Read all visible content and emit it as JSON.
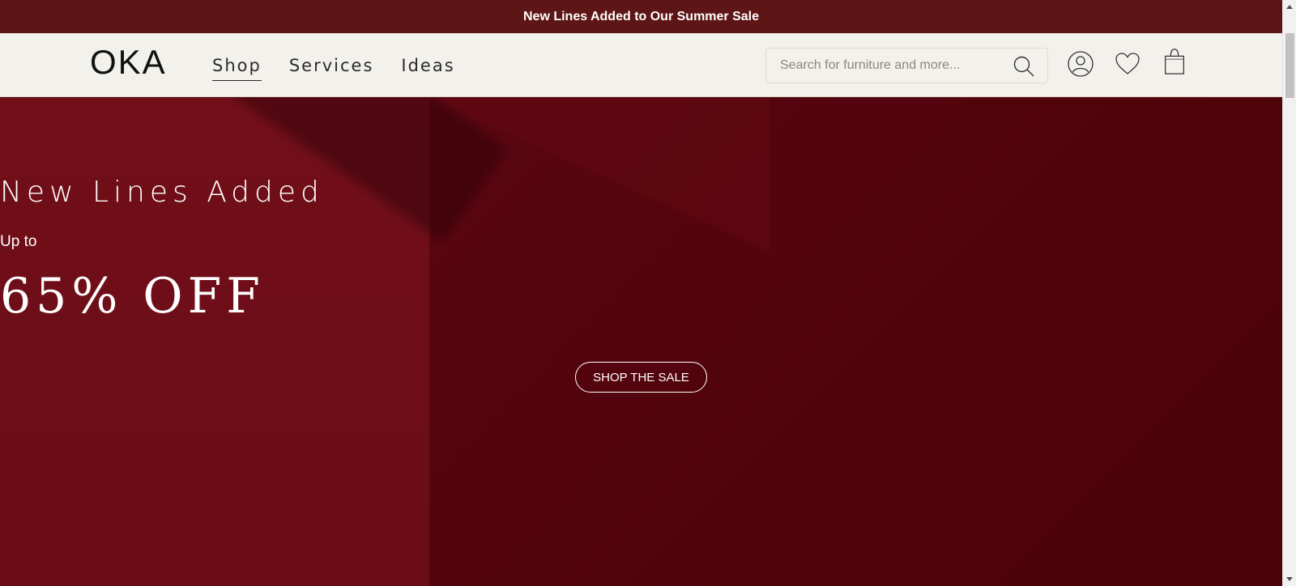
{
  "announcement": {
    "text": "New Lines Added to Our Summer Sale"
  },
  "header": {
    "logo": "OKA",
    "nav": [
      {
        "label": "Shop",
        "active": true
      },
      {
        "label": "Services",
        "active": false
      },
      {
        "label": "Ideas",
        "active": false
      }
    ],
    "search": {
      "placeholder": "Search for furniture and more...",
      "value": ""
    },
    "icons": [
      "search-icon",
      "account-icon",
      "wishlist-icon",
      "bag-icon"
    ]
  },
  "hero": {
    "heading": "New Lines Added",
    "subheading": "Up to",
    "discount": "65% OFF",
    "cta_label": "SHOP THE SALE"
  },
  "colors": {
    "announcement_bg": "#5e1515",
    "header_bg": "#f3f1ec",
    "hero_bg": "#5a0810",
    "text_light": "#ffffff"
  }
}
